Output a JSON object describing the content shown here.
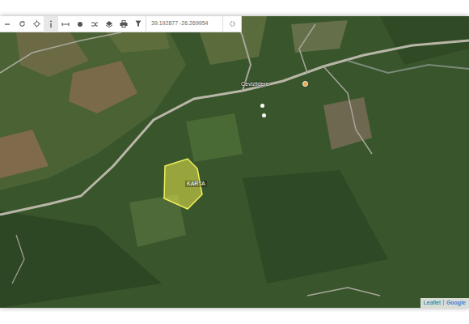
{
  "toolbar": {
    "coordinates": "39.192877 -26.269954"
  },
  "map": {
    "village_label": "Cevizlidere",
    "parcel_label": "KARTA",
    "points": [
      {
        "kind": "poi"
      },
      {
        "kind": "dot"
      },
      {
        "kind": "dot"
      }
    ]
  },
  "attribution": {
    "leaflet": "Leaflet",
    "google": "Google"
  }
}
